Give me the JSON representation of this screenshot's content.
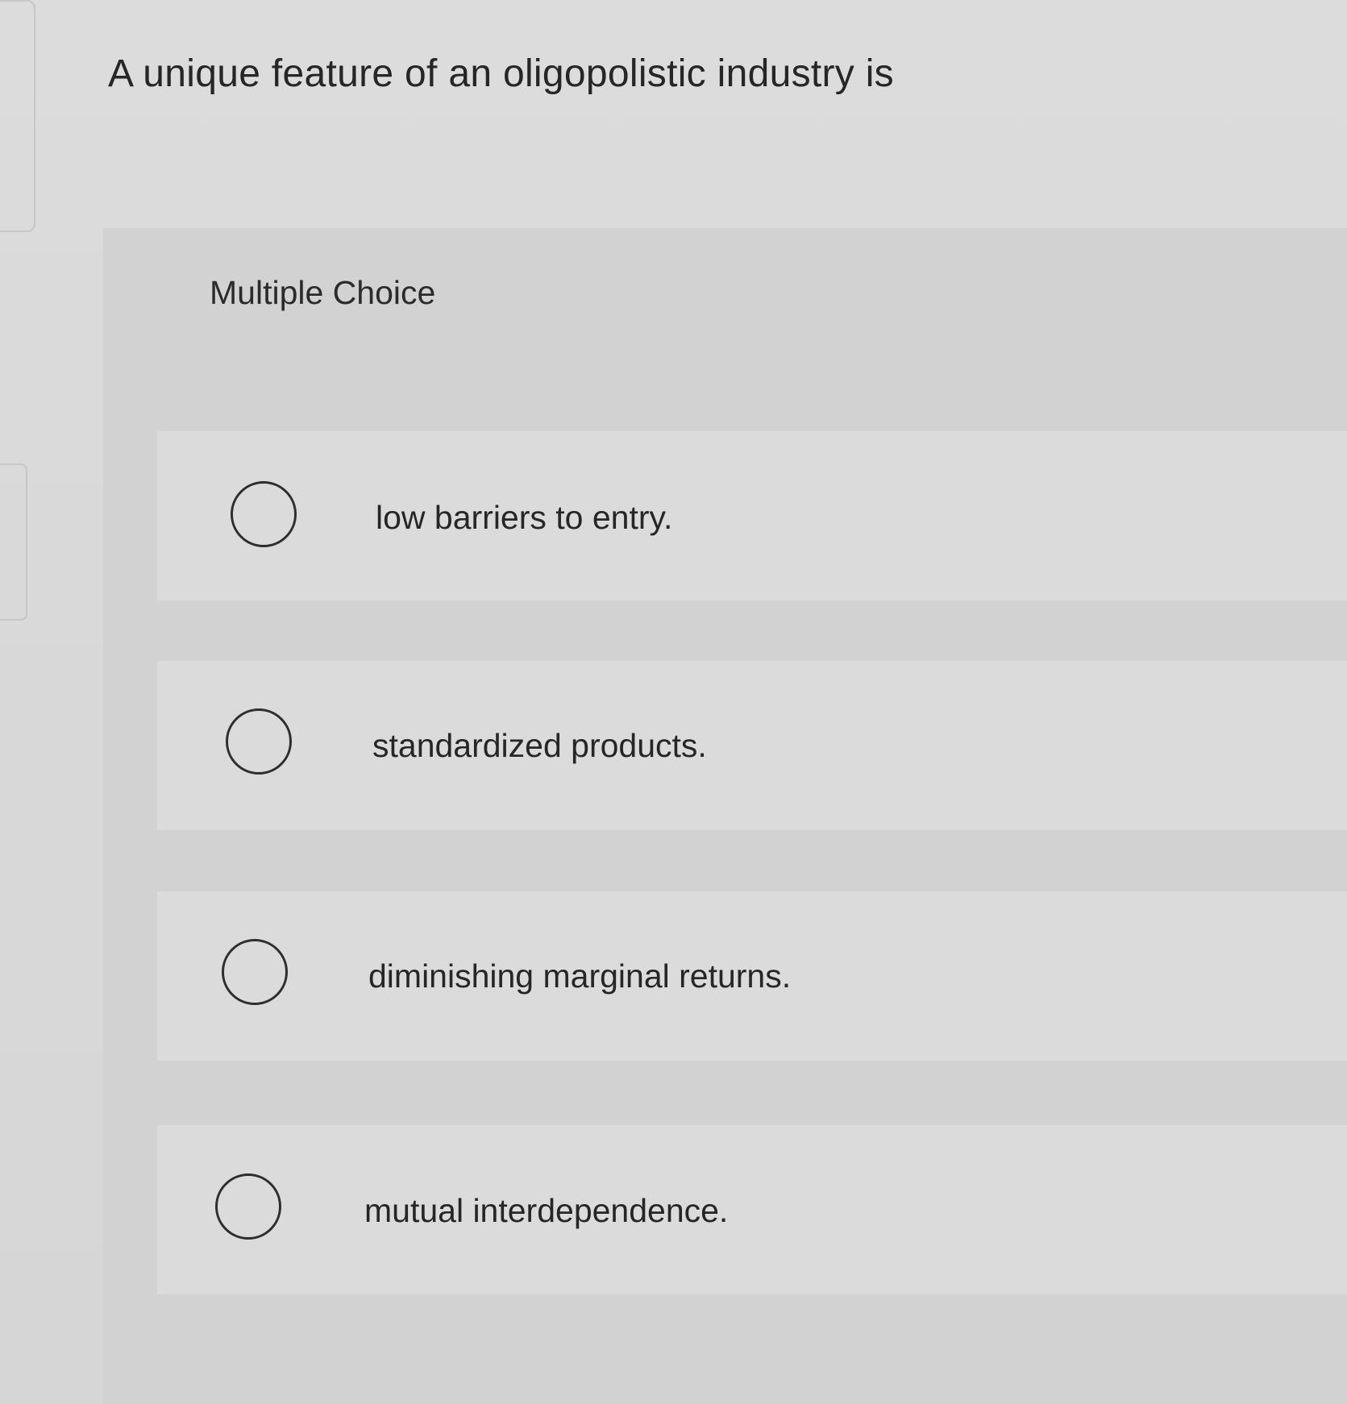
{
  "question": {
    "text": "A unique feature of an oligopolistic industry is"
  },
  "section": {
    "label": "Multiple Choice"
  },
  "options": [
    {
      "label": "low barriers to entry."
    },
    {
      "label": "standardized products."
    },
    {
      "label": "diminishing marginal returns."
    },
    {
      "label": "mutual interdependence."
    }
  ]
}
